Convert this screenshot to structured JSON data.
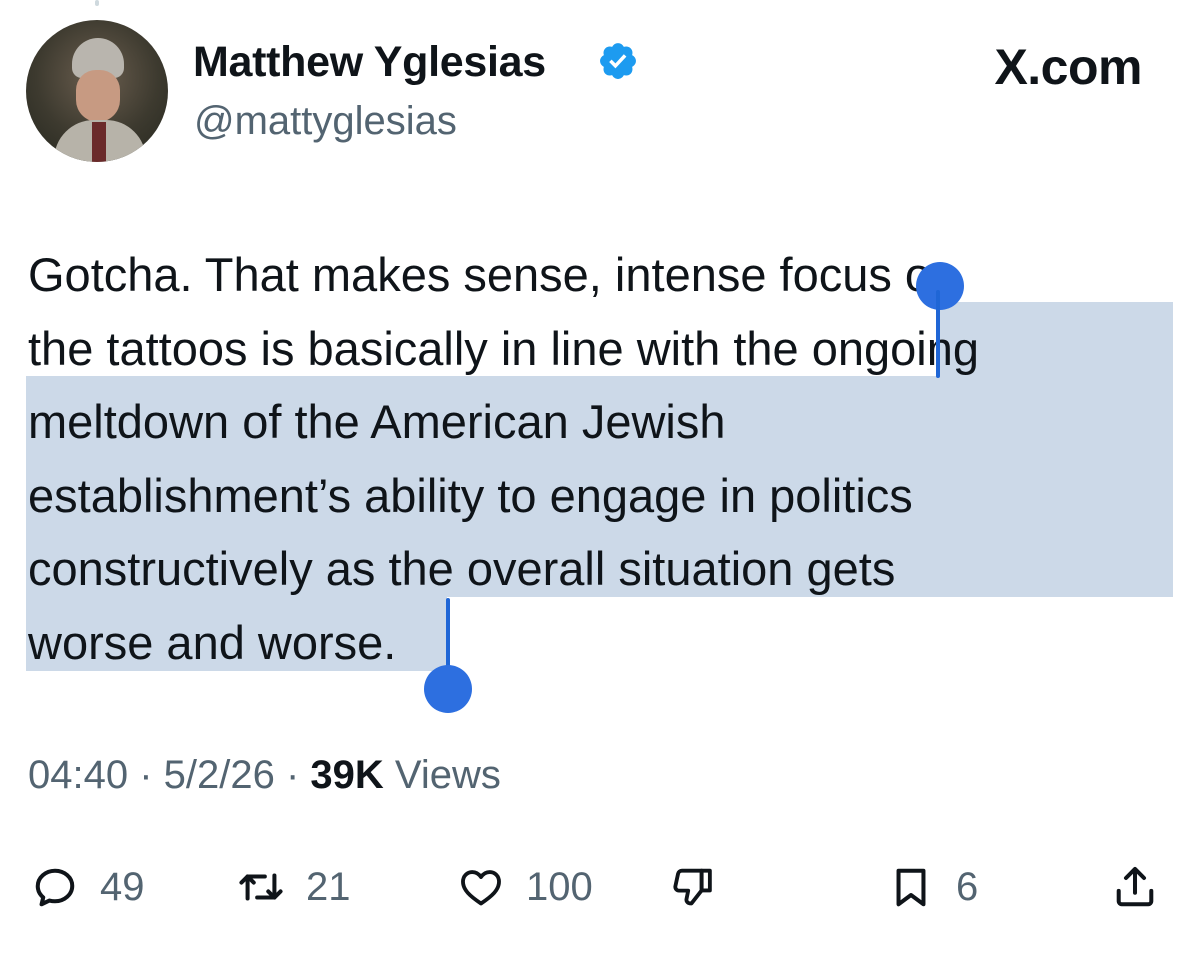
{
  "author": {
    "display_name": "Matthew Yglesias",
    "handle": "@mattyglesias",
    "verified": true,
    "verified_color": "#1d9bf0"
  },
  "source_label": "X.com",
  "tweet": {
    "lines": [
      "Gotcha. That makes sense, intense focus on",
      "the tattoos is basically in line with the ongoing",
      "meltdown of the American Jewish",
      "establishment’s ability to engage in politics",
      "constructively as the overall situation gets",
      "worse and worse."
    ]
  },
  "meta": {
    "time": "04:40",
    "separator": " · ",
    "date": "5/2/26",
    "views_count": "39K",
    "views_label": " Views"
  },
  "actions": {
    "reply_count": "49",
    "retweet_count": "21",
    "like_count": "100",
    "bookmark_count": "6"
  },
  "icons": [
    "verified-badge-icon",
    "reply-icon",
    "retweet-icon",
    "heart-icon",
    "dislike-icon",
    "bookmark-icon",
    "share-icon"
  ],
  "colors": {
    "text": "#0f1419",
    "secondary": "#536471",
    "selection": "#ccd9e8",
    "selection_handle": "#2d6fe0"
  }
}
